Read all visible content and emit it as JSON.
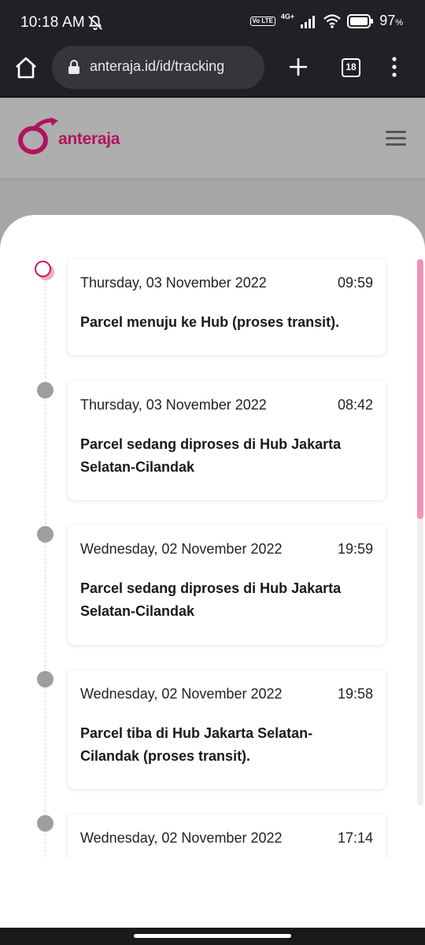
{
  "status_bar": {
    "time": "10:18 AM",
    "volte": "Vo LTE",
    "network": "4G+",
    "battery": "97",
    "battery_unit": "%"
  },
  "browser": {
    "url": "anteraja.id/id/tracking",
    "tab_count": "18"
  },
  "site": {
    "logo_text": "anteraja",
    "brand_color": "#b0145e"
  },
  "tracking": {
    "events": [
      {
        "date": "Thursday, 03 November 2022",
        "time": "09:59",
        "message": "Parcel menuju ke Hub (proses transit).",
        "active": true
      },
      {
        "date": "Thursday, 03 November 2022",
        "time": "08:42",
        "message": "Parcel sedang diproses di Hub Jakarta Selatan-Cilandak"
      },
      {
        "date": "Wednesday, 02 November 2022",
        "time": "19:59",
        "message": "Parcel sedang diproses di Hub Jakarta Selatan-Cilandak"
      },
      {
        "date": "Wednesday, 02 November 2022",
        "time": "19:58",
        "message": "Parcel tiba di Hub Jakarta Selatan-Cilandak (proses transit)."
      },
      {
        "date": "Wednesday, 02 November 2022",
        "time": "17:14",
        "message": ""
      }
    ]
  }
}
